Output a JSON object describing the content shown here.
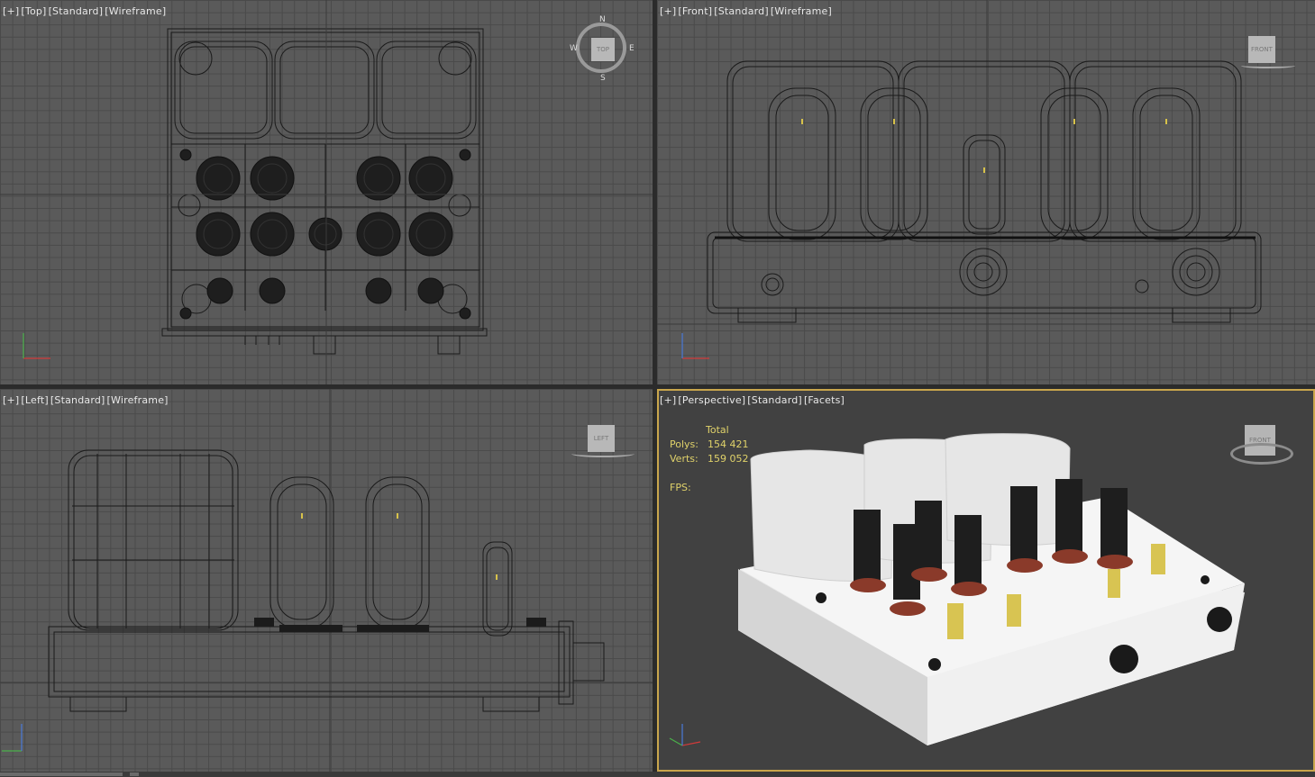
{
  "viewports": {
    "top": {
      "labels": [
        "[+]",
        "[Top]",
        "[Standard]",
        "[Wireframe]"
      ],
      "gizmo": {
        "N": "N",
        "S": "S",
        "E": "E",
        "W": "W",
        "face": "TOP"
      }
    },
    "front": {
      "labels": [
        "[+]",
        "[Front]",
        "[Standard]",
        "[Wireframe]"
      ],
      "gizmo": {
        "face": "FRONT"
      }
    },
    "left": {
      "labels": [
        "[+]",
        "[Left]",
        "[Standard]",
        "[Wireframe]"
      ],
      "gizmo": {
        "face": "LEFT"
      }
    },
    "persp": {
      "labels": [
        "[+]",
        "[Perspective]",
        "[Standard]",
        "[Facets]"
      ],
      "gizmo": {
        "face": "FRONT"
      }
    }
  },
  "stats": {
    "header": "Total",
    "polys_label": "Polys:",
    "polys_value": "154 421",
    "verts_label": "Verts:",
    "verts_value": "159 052",
    "fps_label": "FPS:"
  },
  "colors": {
    "active_border": "#c9a64c",
    "wire": "#1a1a1a",
    "grid_bg": "#5a5a5a",
    "persp_bg": "#414141",
    "stat_text": "#e0d26a"
  }
}
